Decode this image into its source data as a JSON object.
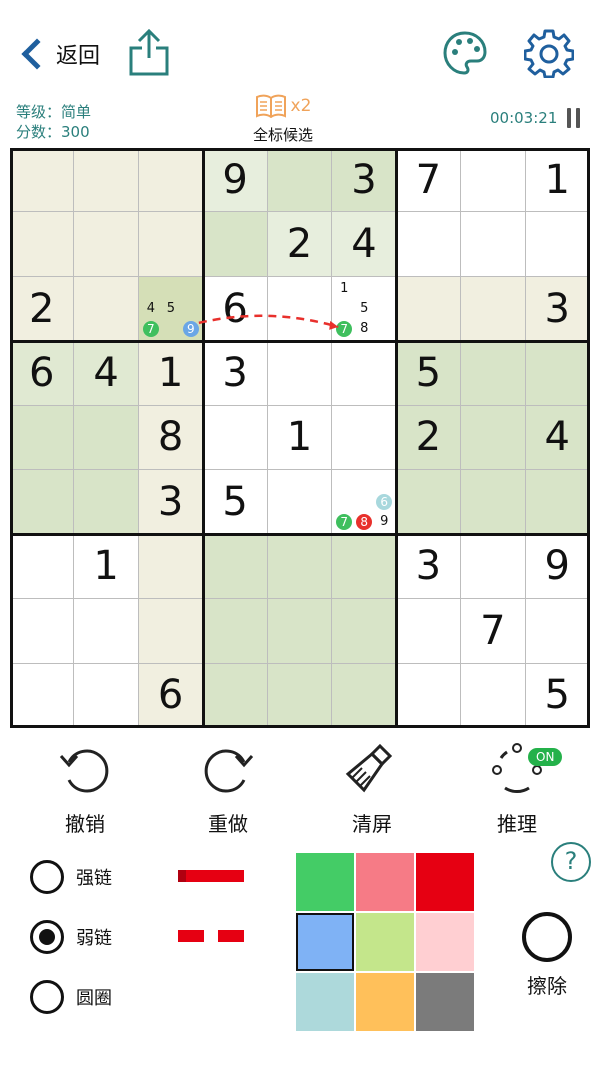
{
  "header": {
    "back_label": "返回"
  },
  "info": {
    "level": "等级：简单",
    "score": "分数：300",
    "multiplier": "x2",
    "mode": "全标候选",
    "timer": "00:03:21"
  },
  "board": {
    "values": [
      [
        "",
        "",
        "",
        "9",
        "",
        "3",
        "7",
        "",
        "1"
      ],
      [
        "",
        "",
        "",
        "",
        "2",
        "4",
        "",
        "",
        ""
      ],
      [
        "2",
        "",
        "",
        "6",
        "",
        "",
        "",
        "",
        "3"
      ],
      [
        "6",
        "4",
        "1",
        "3",
        "",
        "",
        "5",
        "",
        ""
      ],
      [
        "",
        "",
        "8",
        "",
        "1",
        "",
        "2",
        "",
        "4"
      ],
      [
        "",
        "",
        "3",
        "5",
        "",
        "",
        "",
        "",
        ""
      ],
      [
        "",
        "1",
        "",
        "",
        "",
        "",
        "3",
        "",
        "9"
      ],
      [
        "",
        "",
        "",
        "",
        "",
        "",
        "",
        "7",
        ""
      ],
      [
        "",
        "",
        "6",
        "",
        "",
        "",
        "",
        "",
        "5"
      ]
    ],
    "cell_colors": [
      [
        "#f1efe0",
        "#f1efe0",
        "#f1efe0",
        "#e7eedd",
        "#d8e4c8",
        "#d8e4c8",
        "#ffffff",
        "#ffffff",
        "#ffffff"
      ],
      [
        "#f1efe0",
        "#f1efe0",
        "#f1efe0",
        "#d8e4c8",
        "#e7eedd",
        "#e7eedd",
        "#ffffff",
        "#ffffff",
        "#ffffff"
      ],
      [
        "#f1efe0",
        "#f1efe0",
        "#d5dfb7",
        "#ffffff",
        "#ffffff",
        "#ffffff",
        "#f1efe0",
        "#f1efe0",
        "#f1efe0"
      ],
      [
        "#e0e9d2",
        "#e0e9d2",
        "#f1efe0",
        "#ffffff",
        "#ffffff",
        "#ffffff",
        "#d8e4c8",
        "#d8e4c8",
        "#d8e4c8"
      ],
      [
        "#d8e4c8",
        "#d8e4c8",
        "#f1efe0",
        "#ffffff",
        "#ffffff",
        "#ffffff",
        "#d8e4c8",
        "#d8e4c8",
        "#d8e4c8"
      ],
      [
        "#d8e4c8",
        "#d8e4c8",
        "#f1efe0",
        "#ffffff",
        "#ffffff",
        "#ffffff",
        "#d8e4c8",
        "#d8e4c8",
        "#d8e4c8"
      ],
      [
        "#ffffff",
        "#ffffff",
        "#f1efe0",
        "#d8e4c8",
        "#d8e4c8",
        "#d8e4c8",
        "#ffffff",
        "#ffffff",
        "#ffffff"
      ],
      [
        "#ffffff",
        "#ffffff",
        "#f1efe0",
        "#d8e4c8",
        "#d8e4c8",
        "#d8e4c8",
        "#ffffff",
        "#ffffff",
        "#ffffff"
      ],
      [
        "#ffffff",
        "#ffffff",
        "#f1efe0",
        "#d8e4c8",
        "#d8e4c8",
        "#d8e4c8",
        "#ffffff",
        "#ffffff",
        "#ffffff"
      ]
    ],
    "candidates": [
      {
        "row": 2,
        "col": 2,
        "digits": [
          "4",
          "5",
          "7",
          "9"
        ],
        "highlight": {
          "7": "#3fbf5e",
          "9": "#6aa6e6"
        }
      },
      {
        "row": 2,
        "col": 5,
        "digits": [
          "1",
          "5",
          "7",
          "8"
        ],
        "highlight": {
          "7": "#3fbf5e"
        }
      },
      {
        "row": 5,
        "col": 5,
        "digits": [
          "6",
          "7",
          "8",
          "9"
        ],
        "highlight": {
          "6": "#a8d8dd",
          "7": "#3fbf5e",
          "8": "#e8302c"
        }
      }
    ],
    "link": {
      "type": "weak",
      "from": {
        "row": 2,
        "col": 2,
        "digit": "9"
      },
      "to": {
        "row": 2,
        "col": 5,
        "digit": "7"
      },
      "color": "#e8302c"
    }
  },
  "tools": {
    "undo": "撤销",
    "redo": "重做",
    "clear": "清屏",
    "reason": "推理",
    "reason_toggle": "ON"
  },
  "link_options": [
    {
      "label": "强链",
      "checked": false,
      "style": "solid"
    },
    {
      "label": "弱链",
      "checked": true,
      "style": "dashed"
    },
    {
      "label": "圆圈",
      "checked": false,
      "style": "none"
    }
  ],
  "palette": [
    "#44cc66",
    "#f67b86",
    "#e60012",
    "#7fb2f5",
    "#c4e68b",
    "#ffcfd2",
    "#add9db",
    "#ffc05a",
    "#7b7b7b"
  ],
  "palette_selected": 3,
  "erase_label": "擦除",
  "help_symbol": "?",
  "accent_color": "#2a7f7c"
}
